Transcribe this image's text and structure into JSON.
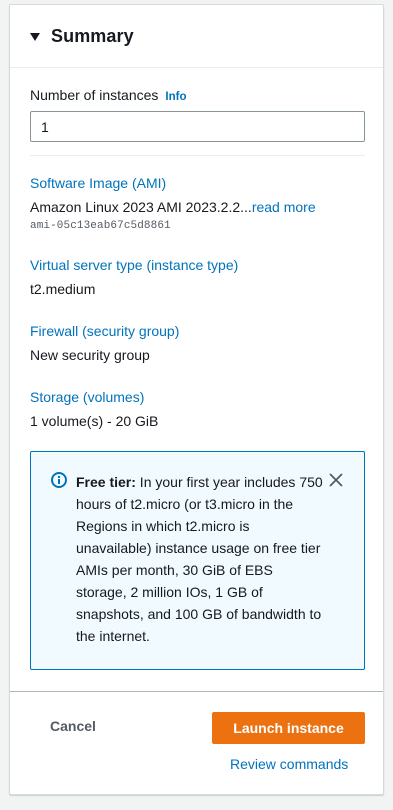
{
  "summary": {
    "title": "Summary",
    "instances": {
      "label": "Number of instances",
      "info_label": "Info",
      "value": "1"
    },
    "ami": {
      "label": "Software Image (AMI)",
      "value": "Amazon Linux 2023 AMI 2023.2.2...",
      "read_more": "read more",
      "id": "ami-05c13eab67c5d8861"
    },
    "instance_type": {
      "label": "Virtual server type (instance type)",
      "value": "t2.medium"
    },
    "firewall": {
      "label": "Firewall (security group)",
      "value": "New security group"
    },
    "storage": {
      "label": "Storage (volumes)",
      "value": "1 volume(s) - 20 GiB"
    },
    "free_tier": {
      "heading": "Free tier:",
      "body": " In your first year includes 750 hours of t2.micro (or t3.micro in the Regions in which t2.micro is unavailable) instance usage on free tier AMIs per month, 30 GiB of EBS storage, 2 million IOs, 1 GB of snapshots, and 100 GB of bandwidth to the internet."
    },
    "actions": {
      "cancel": "Cancel",
      "launch": "Launch instance",
      "review": "Review commands"
    }
  },
  "icons": {
    "collapse": "caret-down-icon",
    "info": "info-circle-icon",
    "close": "close-icon"
  },
  "colors": {
    "link": "#0073bb",
    "primary_button": "#ec7211",
    "alert_bg": "#f1faff",
    "alert_border": "#0073bb"
  }
}
